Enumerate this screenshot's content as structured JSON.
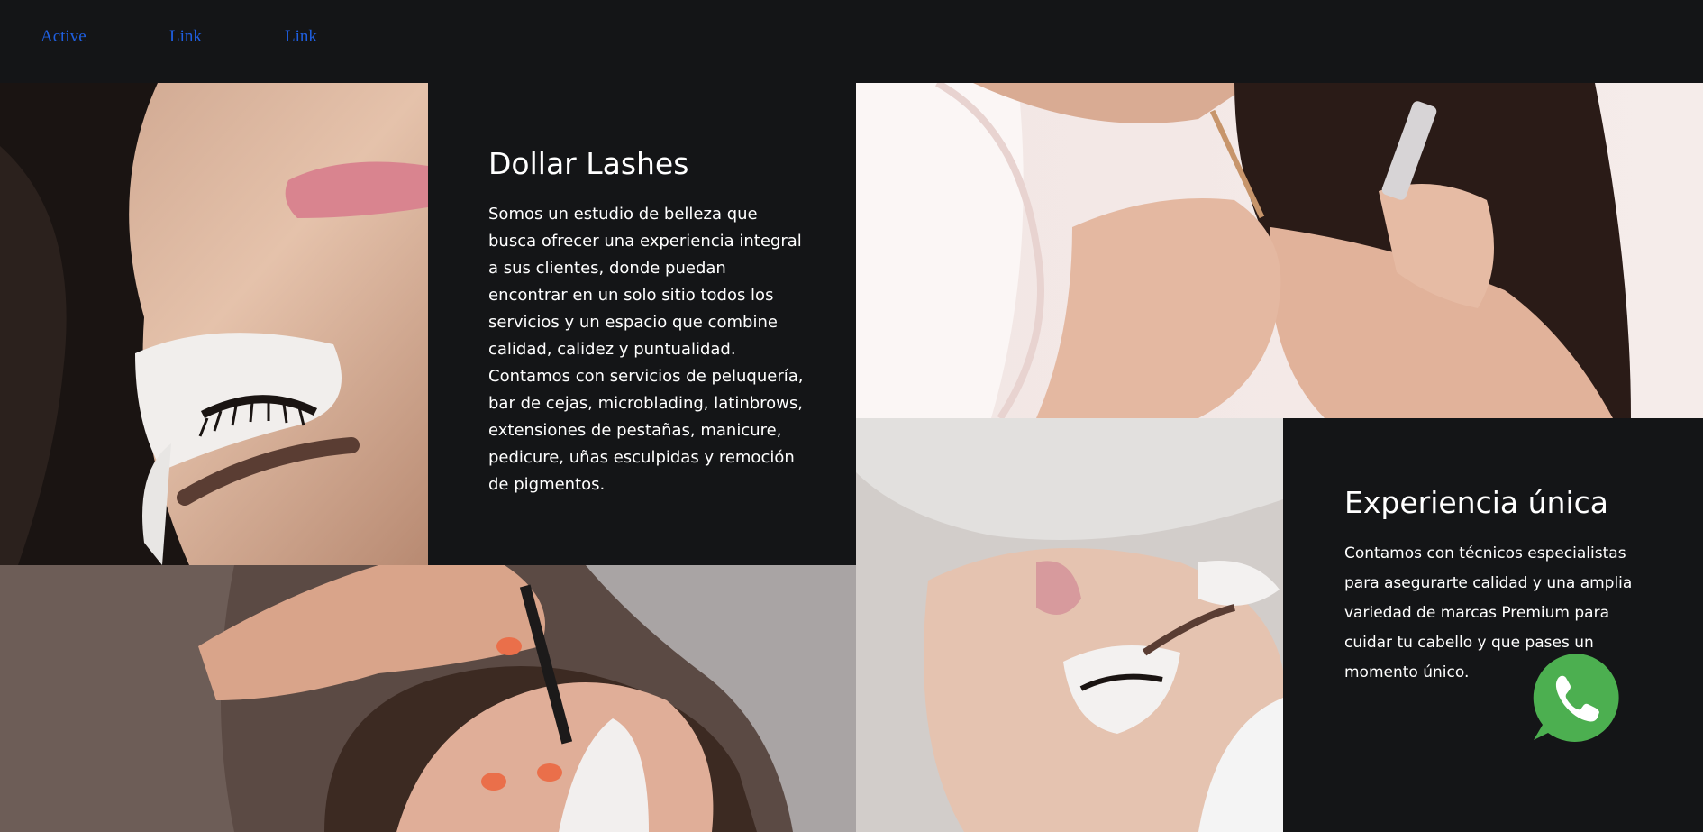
{
  "nav": {
    "items": [
      {
        "label": "Active"
      },
      {
        "label": "Link"
      },
      {
        "label": "Link"
      }
    ]
  },
  "about": {
    "title": "Dollar Lashes",
    "body": "Somos un estudio de belleza que busca ofrecer una experiencia integral a sus clientes, donde puedan encontrar en un solo sitio todos los servicios y un espacio que combine calidad, calidez y puntualidad. Contamos con servicios de peluquería, bar de cejas, microblading, latinbrows, extensiones de pestañas, manicure, pedicure, uñas esculpidas y remoción de pigmentos."
  },
  "experience": {
    "title": "Experiencia única",
    "body": "Contamos con técnicos especialistas para asegurarte calidad y una amplia variedad de marcas Premium para cuidar tu cabello y que pases un momento único."
  },
  "images": [
    {
      "icon": "eyelash-closeup-photo"
    },
    {
      "icon": "lash-application-photo"
    },
    {
      "icon": "tweezers-lash-photo"
    },
    {
      "icon": "lash-client-photo"
    }
  ],
  "whatsapp": {
    "icon": "whatsapp-icon",
    "color": "#4caf50"
  },
  "colors": {
    "background": "#141517",
    "link": "#1f5fe0",
    "text": "#ffffff"
  }
}
